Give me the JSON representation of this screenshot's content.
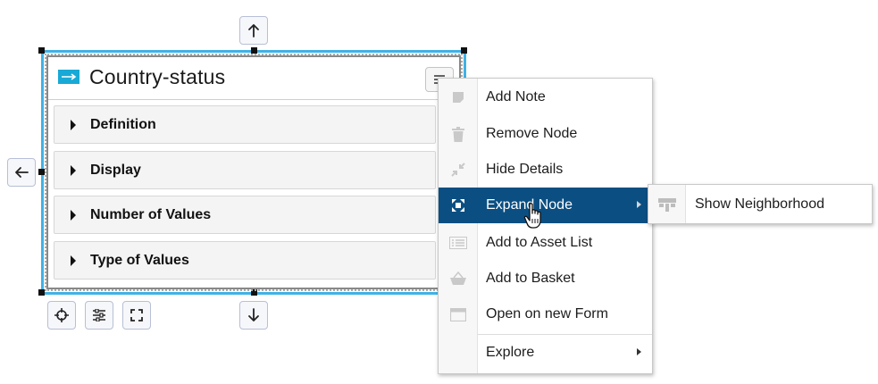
{
  "node": {
    "title": "Country-status",
    "type_icon": "arrow-right-icon",
    "sections": [
      {
        "label": "Definition"
      },
      {
        "label": "Display"
      },
      {
        "label": "Number of Values"
      },
      {
        "label": "Type of Values"
      }
    ]
  },
  "controls": {
    "move_up_icon": "arrow-up-icon",
    "move_down_icon": "arrow-down-icon",
    "move_left_icon": "arrow-left-icon",
    "bottom_tools": [
      "crosshair-icon",
      "sliders-icon",
      "fullscreen-icon"
    ]
  },
  "context_menu": {
    "items": [
      {
        "label": "Add Note",
        "icon": "note-icon"
      },
      {
        "label": "Remove Node",
        "icon": "trash-icon"
      },
      {
        "label": "Hide Details",
        "icon": "collapse-icon"
      },
      {
        "label": "Expand Node",
        "icon": "expand-icon",
        "active": true,
        "has_submenu": true
      },
      {
        "label": "Add to Asset List",
        "icon": "list-icon"
      },
      {
        "label": "Add to Basket",
        "icon": "basket-icon"
      },
      {
        "label": "Open on new Form",
        "icon": "window-icon"
      },
      {
        "label": "Explore",
        "icon": "",
        "has_submenu": true
      }
    ],
    "active_color": "#0b4f82"
  },
  "submenu": {
    "items": [
      {
        "label": "Show Neighborhood",
        "icon": "hierarchy-icon"
      }
    ]
  },
  "colors": {
    "selection": "#3fb2e6",
    "type_icon": "#18a9d6"
  }
}
